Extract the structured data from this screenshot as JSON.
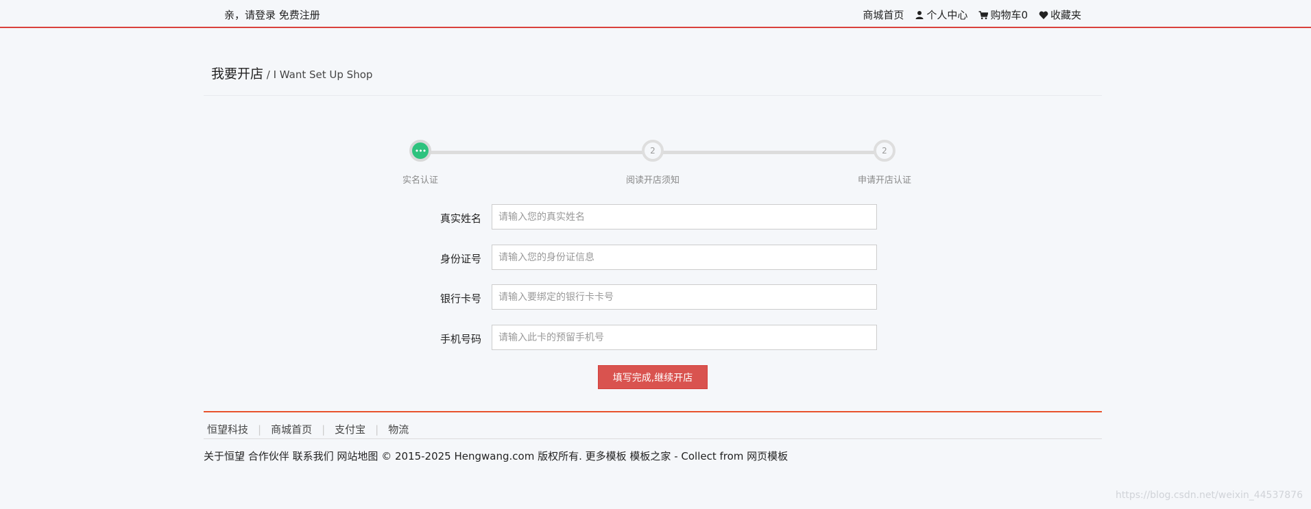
{
  "topbar": {
    "greeting": "亲，请登录",
    "register": "免费注册",
    "links": {
      "home": "商城首页",
      "account": "个人中心",
      "cart": "购物车0",
      "favorites": "收藏夹"
    }
  },
  "page": {
    "title": "我要开店",
    "subtitle": " / I Want  Set Up Shop"
  },
  "steps": [
    {
      "label": "实名认证",
      "marker": "•••",
      "state": "active"
    },
    {
      "label": "阅读开店须知",
      "marker": "2",
      "state": "inactive"
    },
    {
      "label": "申请开店认证",
      "marker": "2",
      "state": "inactive"
    }
  ],
  "form": {
    "fields": [
      {
        "label": "真实姓名",
        "placeholder": "请输入您的真实姓名"
      },
      {
        "label": "身份证号",
        "placeholder": "请输入您的身份证信息"
      },
      {
        "label": "银行卡号",
        "placeholder": "请输入要绑定的银行卡卡号"
      },
      {
        "label": "手机号码",
        "placeholder": "请输入此卡的预留手机号"
      }
    ],
    "submit": "填写完成,继续开店"
  },
  "footer": {
    "nav": [
      "恒望科技",
      "商城首页",
      "支付宝",
      "物流"
    ],
    "about": "关于恒望",
    "partners": "合作伙伴",
    "contact": "联系我们",
    "sitemap": "网站地图",
    "copyright": "© 2015-2025 Hengwang.com 版权所有. 更多模板",
    "template_home": "模板之家",
    "collect": " - Collect from ",
    "web_templates": "网页模板"
  },
  "watermark": "https://blog.csdn.net/weixin_44537876",
  "colors": {
    "accent_red": "#d9534f",
    "topbar_border": "#d9403a",
    "footer_line": "#e8512a",
    "step_active": "#2ec27e"
  }
}
